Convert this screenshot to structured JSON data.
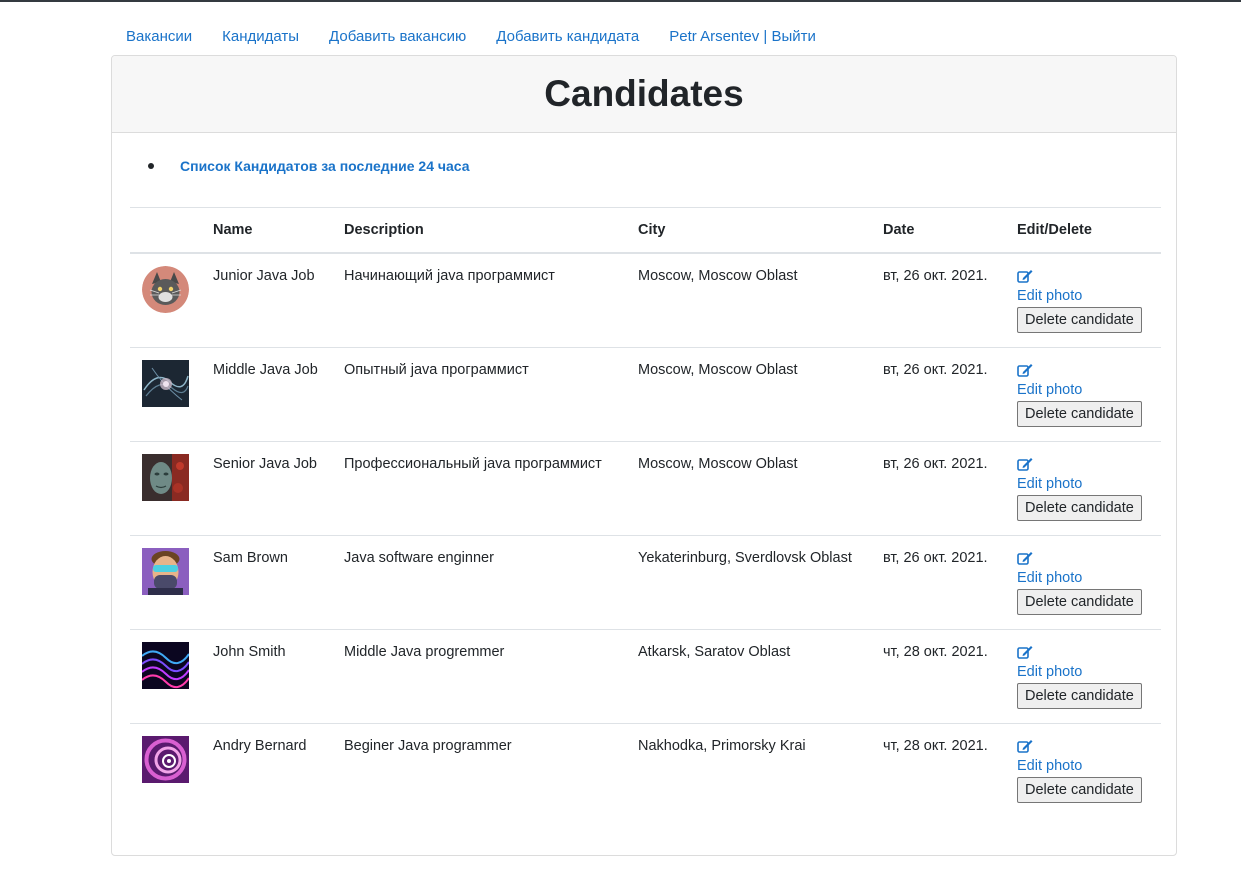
{
  "nav": {
    "items": [
      "Вакансии",
      "Кандидаты",
      "Добавить вакансию",
      "Добавить кандидата",
      "Petr Arsentev | Выйти"
    ]
  },
  "card": {
    "title": "Candidates",
    "recent_link": "Список Кандидатов за последние 24 часа"
  },
  "table": {
    "headers": [
      "",
      "Name",
      "Description",
      "City",
      "Date",
      "Edit/Delete"
    ],
    "edit_photo_label": "Edit photo",
    "delete_label": "Delete candidate",
    "rows": [
      {
        "name": "Junior Java Job",
        "description": "Начинающий java программист",
        "city": "Moscow, Moscow Oblast",
        "date": "вт, 26 окт. 2021.",
        "avatar": "cat-avatar"
      },
      {
        "name": "Middle Java Job",
        "description": "Опытный java программист",
        "city": "Moscow, Moscow Oblast",
        "date": "вт, 26 окт. 2021.",
        "avatar": "fractal-avatar"
      },
      {
        "name": "Senior Java Job",
        "description": "Профессиональный java программист",
        "city": "Moscow, Moscow Oblast",
        "date": "вт, 26 окт. 2021.",
        "avatar": "face-art-avatar"
      },
      {
        "name": "Sam Brown",
        "description": "Java software enginner",
        "city": "Yekaterinburg, Sverdlovsk Oblast",
        "date": "вт, 26 окт. 2021.",
        "avatar": "masked-man-avatar"
      },
      {
        "name": "John Smith",
        "description": "Middle Java progremmer",
        "city": "Atkarsk, Saratov Oblast",
        "date": "чт, 28 окт. 2021.",
        "avatar": "neon-waves-avatar"
      },
      {
        "name": "Andry Bernard",
        "description": "Beginer Java programmer",
        "city": "Nakhodka, Primorsky Krai",
        "date": "чт, 28 окт. 2021.",
        "avatar": "swirl-avatar"
      }
    ]
  },
  "colors": {
    "link": "#1a73c9",
    "header_bg": "#f7f7f7",
    "text": "#212529"
  }
}
